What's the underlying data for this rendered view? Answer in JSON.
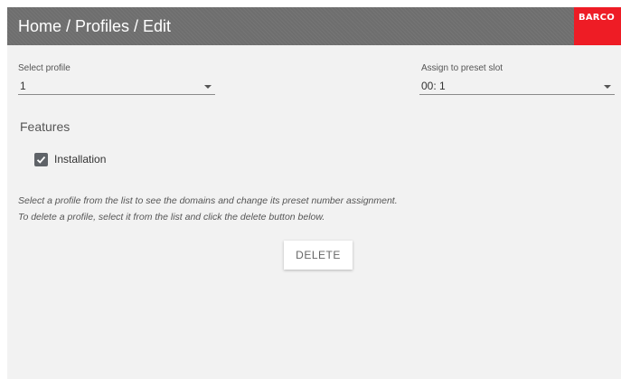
{
  "header": {
    "breadcrumb": "Home / Profiles / Edit",
    "brand": "BARCO",
    "brand_color": "#ee1c25",
    "background_color": "#6e6e6e"
  },
  "select_profile": {
    "label": "Select profile",
    "value": "1",
    "icon": "chevron-down-icon"
  },
  "preset_slot": {
    "label": "Assign to preset slot",
    "value": "00: 1",
    "icon": "chevron-down-icon"
  },
  "features": {
    "title": "Features",
    "items": [
      {
        "label": "Installation",
        "checked": true
      }
    ]
  },
  "help": {
    "line1": "Select a profile from the list to see the domains and change its preset number assignment.",
    "line2": "To delete a profile, select it from the list and click the delete button below."
  },
  "actions": {
    "delete_label": "DELETE"
  }
}
